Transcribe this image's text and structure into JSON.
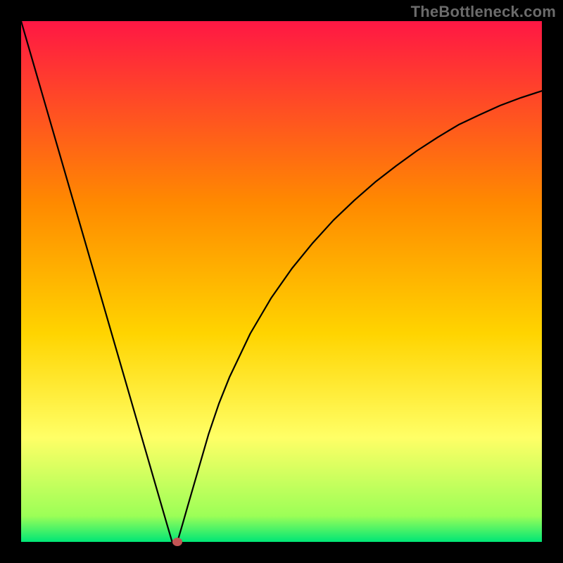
{
  "watermark": {
    "text": "TheBottleneck.com"
  },
  "colors": {
    "frame": "#000000",
    "curve": "#000000",
    "dot": "#c25454",
    "grad_top": "#ff1744",
    "grad_mid1": "#ff8a00",
    "grad_mid2": "#ffd400",
    "grad_mid3": "#ffff66",
    "grad_near_bottom": "#9cff57",
    "grad_bottom": "#00e676"
  },
  "chart_data": {
    "type": "line",
    "title": "",
    "xlabel": "",
    "ylabel": "",
    "xlim": [
      0,
      1
    ],
    "ylim": [
      0,
      1
    ],
    "grid": false,
    "x": [
      0.0,
      0.02,
      0.04,
      0.06,
      0.08,
      0.1,
      0.12,
      0.14,
      0.16,
      0.18,
      0.2,
      0.22,
      0.24,
      0.26,
      0.28,
      0.29,
      0.295,
      0.3,
      0.31,
      0.32,
      0.34,
      0.36,
      0.38,
      0.4,
      0.44,
      0.48,
      0.52,
      0.56,
      0.6,
      0.64,
      0.68,
      0.72,
      0.76,
      0.8,
      0.84,
      0.88,
      0.92,
      0.96,
      1.0
    ],
    "values": [
      1.0,
      0.931,
      0.862,
      0.793,
      0.724,
      0.655,
      0.586,
      0.517,
      0.448,
      0.379,
      0.31,
      0.241,
      0.172,
      0.103,
      0.034,
      0.0,
      0.0,
      0.0,
      0.034,
      0.069,
      0.138,
      0.207,
      0.266,
      0.316,
      0.4,
      0.468,
      0.525,
      0.574,
      0.618,
      0.656,
      0.691,
      0.722,
      0.751,
      0.777,
      0.801,
      0.82,
      0.838,
      0.853,
      0.866
    ],
    "marker": {
      "x": 0.3,
      "y": 0.0
    },
    "annotations": []
  }
}
